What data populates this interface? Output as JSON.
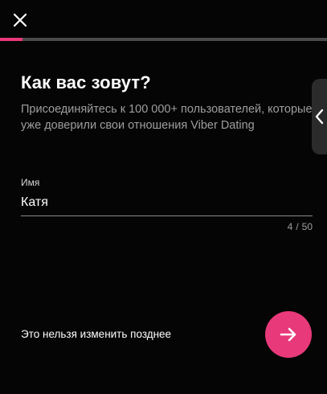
{
  "header": {
    "close_icon": "close-icon",
    "progress": 0.07
  },
  "content": {
    "title": "Как вас зовут?",
    "subtitle": "Присоединяйтесь к 100 000+ пользователей, которые уже доверили свои отношения Viber Dating"
  },
  "name_field": {
    "label": "Имя",
    "value": "Катя",
    "count": "4",
    "separator": "/",
    "max": "50"
  },
  "side_tab": {
    "icon": "chevron-left-icon"
  },
  "footer": {
    "hint": "Это нельзя изменить позднее",
    "next_icon": "arrow-right-icon"
  },
  "colors": {
    "accent": "#e8397a",
    "background": "#050505",
    "track": "#4a4a4a",
    "muted_text": "#9e9e9e"
  }
}
